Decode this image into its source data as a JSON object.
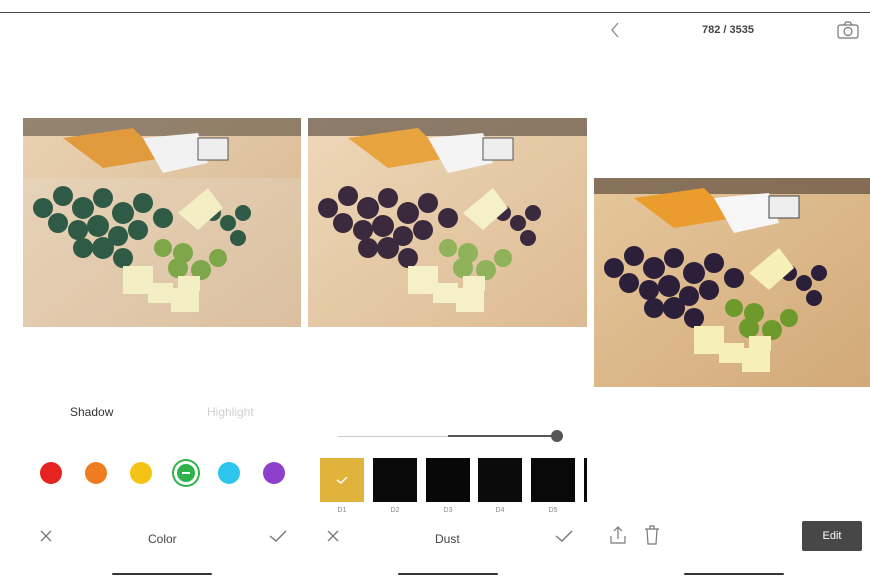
{
  "panel1": {
    "tabs": [
      {
        "label": "Shadow",
        "active": true
      },
      {
        "label": "Highlight",
        "active": false
      }
    ],
    "colors": [
      "#e52421",
      "#ee7d22",
      "#f5c315",
      "#2fb24a",
      "#2ec4ec",
      "#8e3fcc"
    ],
    "selected_color_index": 3,
    "bottom_label": "Color"
  },
  "panel2": {
    "slider_value": 1.0,
    "filters": [
      {
        "label": "D1",
        "selected": true
      },
      {
        "label": "D2",
        "selected": false
      },
      {
        "label": "D3",
        "selected": false
      },
      {
        "label": "D4",
        "selected": false
      },
      {
        "label": "D5",
        "selected": false
      }
    ],
    "bottom_label": "Dust"
  },
  "panel3": {
    "counter": "782 / 3535",
    "edit_label": "Edit"
  },
  "icons": {
    "close": "close-icon",
    "confirm": "check-icon",
    "back": "chevron-left-icon",
    "camera": "camera-icon",
    "share": "share-icon",
    "delete": "trash-icon"
  }
}
